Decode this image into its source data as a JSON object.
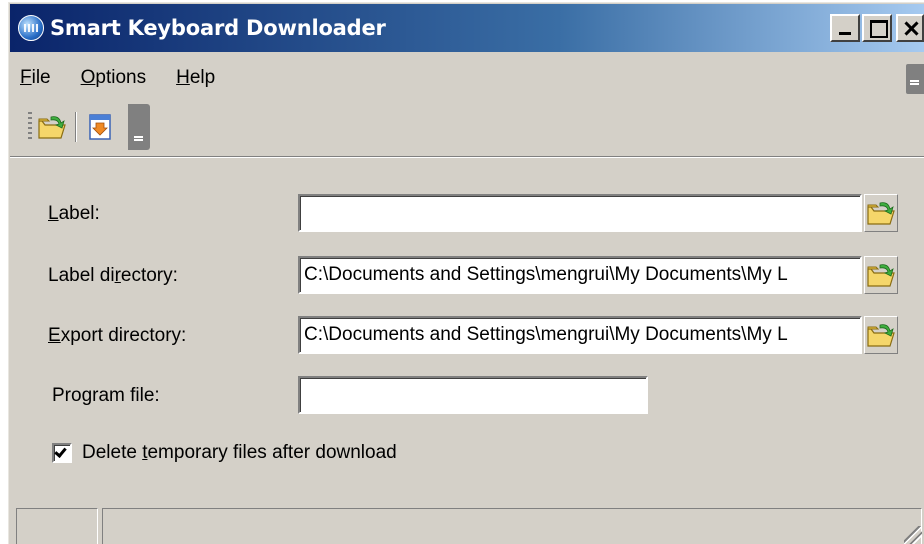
{
  "window": {
    "title": "Smart Keyboard Downloader",
    "controls": [
      "minimize",
      "maximize",
      "close"
    ]
  },
  "menu": {
    "items": [
      {
        "label": "File",
        "mnemonic": "F",
        "rest": "ile"
      },
      {
        "label": "Options",
        "mnemonic": "O",
        "rest": "ptions"
      },
      {
        "label": "Help",
        "mnemonic": "H",
        "rest": "elp"
      }
    ]
  },
  "toolbar": {
    "buttons": [
      {
        "icon": "open-folder-icon"
      },
      {
        "icon": "download-icon"
      }
    ]
  },
  "form": {
    "label": {
      "prefix": "",
      "mnemonic": "L",
      "suffix": "abel:",
      "value": ""
    },
    "label_directory": {
      "prefix": "Label di",
      "mnemonic": "r",
      "suffix": "ectory:",
      "value": "C:\\Documents and Settings\\mengrui\\My Documents\\My L"
    },
    "export_directory": {
      "prefix": "",
      "mnemonic": "E",
      "suffix": "xport directory:",
      "value": "C:\\Documents and Settings\\mengrui\\My Documents\\My L"
    },
    "program_file": {
      "label": "Program file:",
      "value": ""
    },
    "delete_temp": {
      "prefix": "Delete ",
      "mnemonic": "t",
      "suffix": "emporary files after download",
      "checked": true
    }
  },
  "colors": {
    "face": "#d4d0c8",
    "title_start": "#0a246a",
    "title_end": "#a6caf0"
  }
}
